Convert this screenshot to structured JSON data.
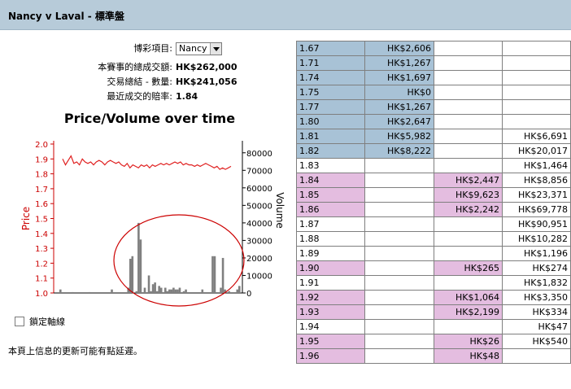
{
  "header": {
    "title": "Nancy v Laval - 標準盤"
  },
  "info": {
    "selection_label": "博彩項目:",
    "selection_value": "Nancy",
    "total_label": "本賽事的總成交額:",
    "total_value": "HK$262,000",
    "summary_label": "交易總結 - 數量:",
    "summary_value": "HK$241,056",
    "last_odds_label": "最近成交的賠率:",
    "last_odds_value": "1.84"
  },
  "chart_data": {
    "type": "line",
    "title": "Price/Volume over time",
    "ylabel": "Price",
    "y2label": "Volume",
    "ylim": [
      1.0,
      2.0
    ],
    "yticks": [
      "2.0",
      "1.9",
      "1.8",
      "1.7",
      "1.6",
      "1.5",
      "1.4",
      "1.3",
      "1.2",
      "1.1",
      "1.0"
    ],
    "y2lim": [
      0,
      85000
    ],
    "y2ticks": [
      "80000",
      "70000",
      "60000",
      "50000",
      "40000",
      "30000",
      "20000",
      "10000",
      "0"
    ],
    "series": [
      {
        "kind": "price",
        "color": "#e02020",
        "values": [
          1.9,
          1.86,
          1.89,
          1.92,
          1.87,
          1.88,
          1.86,
          1.9,
          1.88,
          1.87,
          1.88,
          1.86,
          1.88,
          1.89,
          1.88,
          1.86,
          1.88,
          1.89,
          1.88,
          1.87,
          1.88,
          1.86,
          1.85,
          1.87,
          1.84,
          1.86,
          1.85,
          1.84,
          1.86,
          1.85,
          1.86,
          1.84,
          1.86,
          1.85,
          1.86,
          1.87,
          1.86,
          1.87,
          1.86,
          1.87,
          1.88,
          1.87,
          1.88,
          1.86,
          1.87,
          1.86,
          1.86,
          1.85,
          1.86,
          1.85,
          1.86,
          1.87,
          1.86,
          1.85,
          1.84,
          1.85,
          1.83,
          1.84,
          1.83,
          1.84,
          1.85
        ]
      },
      {
        "kind": "volume",
        "color": "#808080",
        "values": [
          2000,
          0,
          0,
          0,
          0,
          0,
          500,
          0,
          0,
          0,
          0,
          0,
          0,
          0,
          500,
          0,
          0,
          0,
          0,
          0,
          0,
          0,
          0,
          0,
          0,
          2000,
          0,
          0,
          0,
          0,
          0,
          0,
          0,
          3000,
          19500,
          21000,
          0,
          1000,
          40000,
          30500,
          0,
          3000,
          0,
          10000,
          1000,
          5000,
          6000,
          1000,
          4000,
          3000,
          0,
          3000,
          1000,
          2000,
          2000,
          3000,
          2000,
          2000,
          3000,
          0,
          1000,
          2000,
          0,
          0,
          0,
          0,
          0,
          0,
          0,
          2000,
          0,
          0,
          0,
          0,
          21000,
          21000,
          0,
          0,
          3000,
          20000,
          2000,
          0,
          1000,
          0,
          0,
          0,
          2000,
          4000
        ]
      }
    ]
  },
  "annotation": {
    "color": "#cc0000"
  },
  "lock_axis_label": "鎖定軸線",
  "note": "本頁上信息的更新可能有點延遲。",
  "odds_table": [
    {
      "odds": "1.67",
      "back": "HK$2,606",
      "lay_a": "",
      "lay_b": "",
      "color": "blue"
    },
    {
      "odds": "1.71",
      "back": "HK$1,267",
      "lay_a": "",
      "lay_b": "",
      "color": "blue"
    },
    {
      "odds": "1.74",
      "back": "HK$1,697",
      "lay_a": "",
      "lay_b": "",
      "color": "blue"
    },
    {
      "odds": "1.75",
      "back": "HK$0",
      "lay_a": "",
      "lay_b": "",
      "color": "blue"
    },
    {
      "odds": "1.77",
      "back": "HK$1,267",
      "lay_a": "",
      "lay_b": "",
      "color": "blue"
    },
    {
      "odds": "1.80",
      "back": "HK$2,647",
      "lay_a": "",
      "lay_b": "",
      "color": "blue"
    },
    {
      "odds": "1.81",
      "back": "HK$5,982",
      "lay_a": "",
      "lay_b": "HK$6,691",
      "color": "blue"
    },
    {
      "odds": "1.82",
      "back": "HK$8,222",
      "lay_a": "",
      "lay_b": "HK$20,017",
      "color": "blue"
    },
    {
      "odds": "1.83",
      "back": "",
      "lay_a": "",
      "lay_b": "HK$1,464",
      "color": "none"
    },
    {
      "odds": "1.84",
      "back": "",
      "lay_a": "HK$2,447",
      "lay_b": "HK$8,856",
      "color": "pink"
    },
    {
      "odds": "1.85",
      "back": "",
      "lay_a": "HK$9,623",
      "lay_b": "HK$23,371",
      "color": "pink"
    },
    {
      "odds": "1.86",
      "back": "",
      "lay_a": "HK$2,242",
      "lay_b": "HK$69,778",
      "color": "pink"
    },
    {
      "odds": "1.87",
      "back": "",
      "lay_a": "",
      "lay_b": "HK$90,951",
      "color": "none"
    },
    {
      "odds": "1.88",
      "back": "",
      "lay_a": "",
      "lay_b": "HK$10,282",
      "color": "none"
    },
    {
      "odds": "1.89",
      "back": "",
      "lay_a": "",
      "lay_b": "HK$1,196",
      "color": "none"
    },
    {
      "odds": "1.90",
      "back": "",
      "lay_a": "HK$265",
      "lay_b": "HK$274",
      "color": "pink"
    },
    {
      "odds": "1.91",
      "back": "",
      "lay_a": "",
      "lay_b": "HK$1,832",
      "color": "none"
    },
    {
      "odds": "1.92",
      "back": "",
      "lay_a": "HK$1,064",
      "lay_b": "HK$3,350",
      "color": "pink"
    },
    {
      "odds": "1.93",
      "back": "",
      "lay_a": "HK$2,199",
      "lay_b": "HK$334",
      "color": "pink"
    },
    {
      "odds": "1.94",
      "back": "",
      "lay_a": "",
      "lay_b": "HK$47",
      "color": "none"
    },
    {
      "odds": "1.95",
      "back": "",
      "lay_a": "HK$26",
      "lay_b": "HK$540",
      "color": "pink"
    },
    {
      "odds": "1.96",
      "back": "",
      "lay_a": "HK$48",
      "lay_b": "",
      "color": "pink"
    }
  ]
}
